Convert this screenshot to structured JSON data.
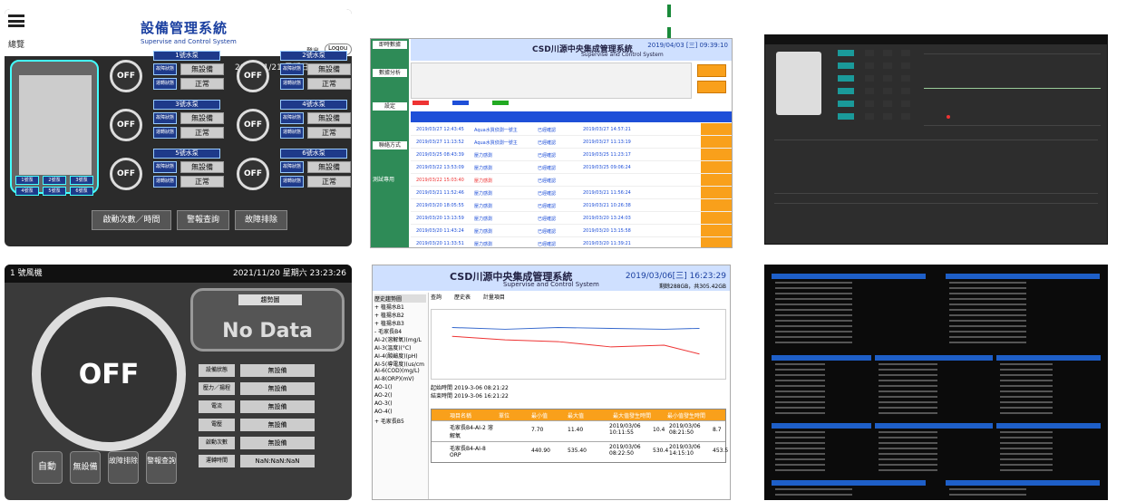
{
  "p1": {
    "title": "設備管理系統",
    "subtitle": "Supervise and Control System",
    "overview": "總覽",
    "login_label": "登出",
    "login_value": "Logou",
    "datetime": "2021/11/21  星期日 08:33:42",
    "pumps": [
      {
        "header": "1號水泵",
        "l1": "故障狀態",
        "v1": "無設備",
        "l2": "運轉狀態",
        "v2": "正常",
        "state": "OFF"
      },
      {
        "header": "2號水泵",
        "l1": "故障狀態",
        "v1": "無設備",
        "l2": "運轉狀態",
        "v2": "正常",
        "state": "OFF"
      },
      {
        "header": "3號水泵",
        "l1": "故障狀態",
        "v1": "無設備",
        "l2": "運轉狀態",
        "v2": "正常",
        "state": "OFF"
      },
      {
        "header": "4號水泵",
        "l1": "故障狀態",
        "v1": "無設備",
        "l2": "運轉狀態",
        "v2": "正常",
        "state": "OFF"
      },
      {
        "header": "5號水泵",
        "l1": "故障狀態",
        "v1": "無設備",
        "l2": "運轉狀態",
        "v2": "正常",
        "state": "OFF"
      },
      {
        "header": "6號水泵",
        "l1": "故障狀態",
        "v1": "無設備",
        "l2": "運轉狀態",
        "v2": "正常",
        "state": "OFF"
      }
    ],
    "building_labels": [
      "1號泵",
      "2號泵",
      "3號泵",
      "4號泵",
      "5號泵",
      "6號泵"
    ],
    "btn_start": "啟動次數／時間",
    "btn_alarm": "警報查詢",
    "btn_fault": "故障排除"
  },
  "p2": {
    "title": "CSD川源中央集成管理系統",
    "subtitle": "Supervise and Control System",
    "datetime": "2019/04/03 [三] 09:39:10",
    "side": [
      "即時數據",
      "數據分析",
      "設定",
      "聯絡方式"
    ],
    "test_label": "測試專用",
    "rows": [
      {
        "t": "2019/03/27 12:43:45",
        "dev": "Aqua水質偵測一號主",
        "st": "已經確認",
        "t2": "2019/03/27 14:57:21"
      },
      {
        "t": "2019/03/27 11:13:52",
        "dev": "Aqua水質偵測一號主",
        "st": "已經確認",
        "t2": "2019/03/27 11:13:19"
      },
      {
        "t": "2019/03/25 08:43:39",
        "dev": "壓力感測",
        "st": "已經確認",
        "t2": "2019/03/25 11:23:17"
      },
      {
        "t": "2019/03/22 13:53:09",
        "dev": "壓力感測",
        "st": "已經確認",
        "t2": "2019/03/25 09:06:24"
      },
      {
        "t": "2019/03/22 15:03:40",
        "dev": "壓力感測",
        "st": "已經確認",
        "t2": ""
      },
      {
        "t": "2019/03/21 11:52:46",
        "dev": "壓力感測",
        "st": "已經確認",
        "t2": "2019/03/21 11:56:24"
      },
      {
        "t": "2019/03/20 18:05:55",
        "dev": "壓力感測",
        "st": "已經確認",
        "t2": "2019/03/21 10:26:38"
      },
      {
        "t": "2019/03/20 13:13:59",
        "dev": "壓力感測",
        "st": "已經確認",
        "t2": "2019/03/20 13:24:03"
      },
      {
        "t": "2019/03/20 11:43:24",
        "dev": "壓力感測",
        "st": "已經確認",
        "t2": "2019/03/20 13:15:58"
      },
      {
        "t": "2019/03/20 11:33:51",
        "dev": "壓力感測",
        "st": "已經確認",
        "t2": "2019/03/20 11:39:21"
      }
    ]
  },
  "p4": {
    "title": "1 號風機",
    "datetime": "2021/11/20  星期六 23:23:26",
    "state": "OFF",
    "panel_title": "趨勢圖",
    "no_data": "No Data",
    "rows": [
      {
        "l": "設備狀態",
        "v": "無設備"
      },
      {
        "l": "壓力／揚程",
        "v": "無設備"
      },
      {
        "l": "電流",
        "v": "無設備"
      },
      {
        "l": "電壓",
        "v": "無設備"
      },
      {
        "l": "啟動次數",
        "v": "無設備"
      },
      {
        "l": "運轉時間",
        "v": "NaN:NaN:NaN"
      }
    ],
    "buttons": [
      "自動",
      "無設備",
      "故障排除",
      "警報查詢"
    ]
  },
  "p5": {
    "title": "CSD川源中央集成管理系統",
    "subtitle": "Supervise and Control System",
    "datetime": "2019/03/06[三] 16:23:29",
    "disk": "剩餘288GB，共305.42GB",
    "tree_header": "歷史趨勢圖",
    "tree": [
      "+ 植揚水B1",
      "+ 植揚水B2",
      "+ 植揚水B3",
      "- 毛家長B4",
      "AI-2(溶解氧)(mg/L",
      "AI-3(溫度)(°C)",
      "AI-4(酸鹼度)(pH)",
      "AI-5(導電度)(us/cm",
      "AI-6(COD)(mg/L)",
      "AI-8(ORP)(mV)",
      "AO-1()",
      "AO-2()",
      "AO-3()",
      "AO-4()",
      "+ 毛家長B5"
    ],
    "tabs": [
      "查詢",
      "歷史表",
      "計量項目"
    ],
    "start_label": "起始時間",
    "start_value": "2019-3-06 08:21:22",
    "end_label": "結束時間",
    "end_value": "2019-3-06 16:21:22",
    "table_headers": [
      "項目名稱",
      "單位",
      "最小值",
      "最大值",
      "最大值發生時間",
      "最小值發生時間"
    ],
    "table_rows": [
      {
        "name": "毛家長B4-AI-2 溶解氧",
        "v1": "7.70",
        "v2": "11.40",
        "t1": "2019/03/06 10:11:55",
        "v3": "10.4",
        "t2": "2019/03/06 08:21:50",
        "v4": "8.7"
      },
      {
        "name": "毛家長B4-AI-8 ORP",
        "v1": "440.90",
        "v2": "535.40",
        "t1": "2019/03/06 08:22:50",
        "v3": "530.4",
        "t2": "2019/03/06 14:15:10",
        "v4": "453.5"
      }
    ]
  }
}
